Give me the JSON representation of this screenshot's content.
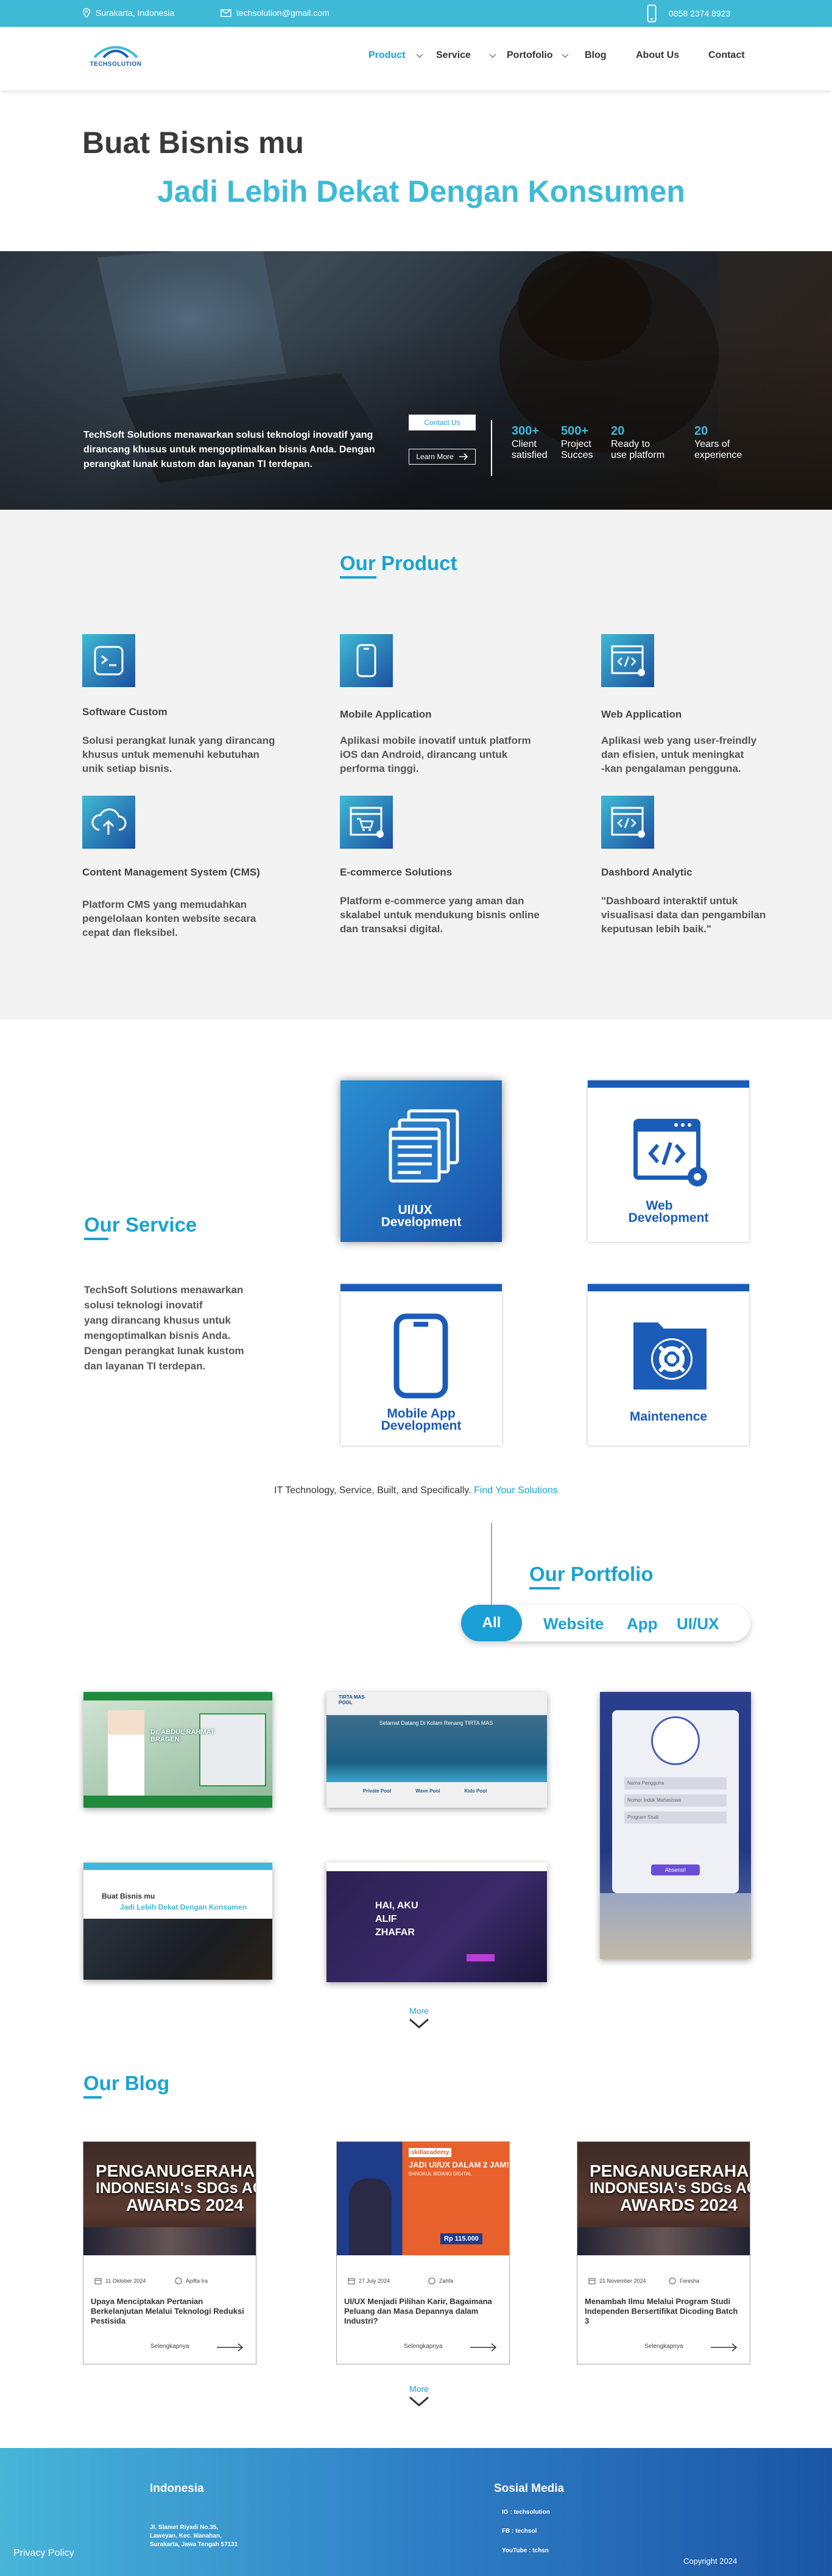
{
  "topbar": {
    "location": "Surakarta, Indonesia",
    "email": "techsolution@gmail.com",
    "phone": "0858 2374 8923"
  },
  "brand": {
    "name": "TECHSOLUTION",
    "accent": "#3ebad6",
    "primary": "#1b5cb8"
  },
  "nav": {
    "items": [
      {
        "label": "Product",
        "active": true,
        "dropdown": true
      },
      {
        "label": "Service",
        "dropdown": true
      },
      {
        "label": "Portofolio",
        "dropdown": true
      },
      {
        "label": "Blog"
      },
      {
        "label": "About Us"
      },
      {
        "label": "Contact"
      }
    ]
  },
  "hero": {
    "line1": "Buat Bisnis mu",
    "line2": "Jadi Lebih Dekat Dengan Konsumen",
    "description": "TechSoft Solutions menawarkan solusi teknologi inovatif yang dirancang khusus untuk mengoptimalkan bisnis Anda. Dengan perangkat lunak kustom dan layanan TI terdepan.",
    "contact_btn": "Contact Us",
    "learn_btn": "Learn More",
    "stats": [
      {
        "num": "300+",
        "l1": "Client",
        "l2": "satisfied"
      },
      {
        "num": "500+",
        "l1": "Project",
        "l2": "Succes"
      },
      {
        "num": "20",
        "l1": "Ready to",
        "l2": "use platform"
      },
      {
        "num": "20",
        "l1": "Years of",
        "l2": "experience"
      }
    ]
  },
  "products": {
    "title": "Our Product",
    "items": [
      {
        "icon": "terminal-icon",
        "title": "Software Custom",
        "desc": [
          "Solusi perangkat lunak yang dirancang",
          "khusus untuk memenuhi kebutuhan",
          "unik setiap bisnis."
        ]
      },
      {
        "icon": "mobile-icon",
        "title": "Mobile Application",
        "desc": [
          "Aplikasi mobile inovatif untuk platform",
          "iOS dan Android, dirancang untuk",
          "performa tinggi."
        ]
      },
      {
        "icon": "web-code-icon",
        "title": "Web Application",
        "desc": [
          "Aplikasi web yang user-freindly",
          "dan efisien, untuk meningkat",
          "-kan pengalaman pengguna."
        ]
      },
      {
        "icon": "cloud-upload-icon",
        "title": "Content Management  System (CMS)",
        "desc": [
          "Platform CMS yang memudahkan",
          "pengelolaan konten website secara",
          " cepat dan fleksibel."
        ]
      },
      {
        "icon": "cart-window-icon",
        "title": "E-commerce Solutions",
        "desc": [
          "Platform e-commerce yang aman dan",
          "skalabel untuk mendukung bisnis online",
          "dan transaksi digital."
        ]
      },
      {
        "icon": "dashboard-window-icon",
        "title": "Dashbord Analytic",
        "desc": [
          "\"Dashboard interaktif untuk",
          "visualisasi data dan pengambilan",
          "keputusan lebih baik.\""
        ]
      }
    ]
  },
  "services": {
    "title": "Our Service",
    "desc": [
      "TechSoft Solutions menawarkan",
      "solusi teknologi inovatif",
      "yang dirancang khusus untuk",
      "mengoptimalkan bisnis Anda.",
      "Dengan perangkat lunak kustom",
      "dan layanan TI terdepan."
    ],
    "cards": [
      {
        "l1": "UI/UX",
        "l2": "Development"
      },
      {
        "l1": "Web",
        "l2": "Development"
      },
      {
        "l1": "Mobile App",
        "l2": "Development"
      },
      {
        "l1": "Maintenence",
        "l2": ""
      }
    ],
    "tagline": "IT Technology, Service, Built, and Specifically.",
    "tagline_link": "Find Your  Solutions"
  },
  "portfolio": {
    "title": "Our Portfolio",
    "filters": [
      "All",
      "Website",
      "App",
      "UI/UX"
    ],
    "more": "More",
    "thumbs": {
      "hospital_banner": "Dr. ABDUL RAHMAT BRAGEN",
      "pool_logo": "TIRTA MAS POOL",
      "pool_headline": "Selamat Datang Di Kolam Renang TIRTA MAS",
      "pool_cards": [
        "Private Pool",
        "Wave Pool",
        "Kids Pool"
      ],
      "self_h1": "Buat Bisnis mu",
      "self_h2": "Jadi Lebih Dekat Dengan Konsumen",
      "hai_l1": "HAI, AKU",
      "hai_l2": "ALIF",
      "hai_l3": "ZHAFAR",
      "form_fields": [
        "Nama Pengguna",
        "Nomor Induk Mahasiswa",
        "Program Studi"
      ],
      "form_btn": "Absensi!"
    }
  },
  "blog": {
    "title": "Our Blog",
    "more": "More",
    "posts": [
      {
        "img_l1": "PENGANUGERAHAN",
        "img_l2": "INDONESIA's SDGs ACTI",
        "img_l3": "AWARDS 2024",
        "date": "11 Oktober 2024",
        "author": "Apifta Ira",
        "title": "Upaya Menciptakan Pertanian Berkelanjutan Melalui Teknologi Reduksi Pestisida",
        "read": "Selengkapnya"
      },
      {
        "img_brand": "skillacademy",
        "img_l1": "JADI UI/UX DALAM 2 JAM!",
        "img_l2": "BANGKUL BIDANG DIGITAL",
        "img_price": "Rp 115.000",
        "date": "27 July 2024",
        "author": "Zahfa",
        "title": "UI/UX Menjadi Pilihan Karir, Bagaimana Peluang dan Masa Depannya dalam Industri?",
        "read": "Selengkapnya"
      },
      {
        "img_l1": "PENGANUGERAHAN",
        "img_l2": "INDONESIA's SDGs ACTI",
        "img_l3": "AWARDS 2024",
        "date": "21 November 2024",
        "author": "Fenisha",
        "title": "Menambah Ilmu Melalui Program Studi Independen Bersertifikat Dicoding Batch 3",
        "read": "Selengkapnya"
      }
    ]
  },
  "footer": {
    "privacy": "Privacy Policy",
    "country": "Indonesia",
    "address": [
      "Jl. Slamet Riyadi No.35,",
      "Laweyan, Kec. Manahan,",
      "Surakarta, Jawa Tengah 57131"
    ],
    "social_title": "Sosial Media",
    "social": [
      "IG : techsolution",
      "FB : techsol",
      "YouTube : tchsn"
    ],
    "copyright": "Copyright 2024"
  }
}
